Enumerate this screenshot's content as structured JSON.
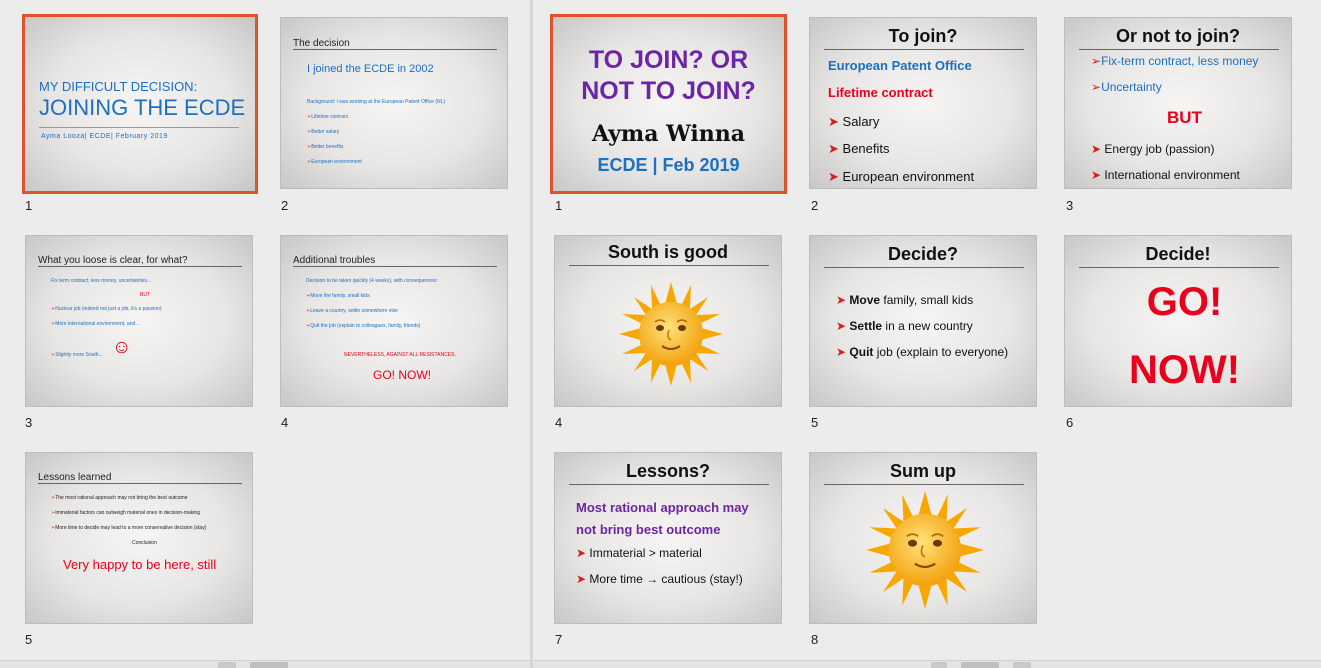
{
  "left": {
    "slides": [
      {
        "num": "1",
        "title_small": "MY DIFFICULT DECISION:",
        "title_big": "JOINING THE ECDE",
        "subtitle": "Ayma Looza| ECDE| February 2019"
      },
      {
        "num": "2",
        "heading": "The decision",
        "headline": "I joined the ECDE in 2002",
        "background": "Background: I was working at the European Patent Office (NL)",
        "bullets": [
          "Lifetime contract",
          "Better salary",
          "Better benefits",
          "European environment"
        ]
      },
      {
        "num": "3",
        "heading": "What you loose is clear, for what?",
        "line1": "Fix term contract, less money, uncertainties...",
        "but": "BUT",
        "bullets": [
          "Nuclear job (indeed not just a job, it's a passion)",
          "More international environment, and..."
        ],
        "last": "Slightly more South...",
        "smiley": "☺"
      },
      {
        "num": "4",
        "heading": "Additional troubles",
        "intro": "Decision to be taken quickly (4 weeks), with consequences:",
        "bullets": [
          "Move the family, small kids",
          "Leave a country, settle somewhere else",
          "Quit the job (explain to colleagues, family, friends)"
        ],
        "nevertheless": "NEVERTHELESS, AGAINST ALL RESISTANCES,",
        "go": "GO! NOW!"
      },
      {
        "num": "5",
        "heading": "Lessons learned",
        "bullets": [
          "The most rational approach may not bring the best outcome",
          "Immaterial factors can outweigh material ones in decision-making",
          "More time to decide may lead to a more conservative decision (stay)"
        ],
        "conclusion": "Conclusion",
        "happy": "Very happy to be here, still"
      }
    ]
  },
  "right": {
    "slides": [
      {
        "num": "1",
        "title1": "TO JOIN? OR",
        "title2": "NOT TO JOIN?",
        "author": "Ayma Winna",
        "org": "ECDE | Feb 2019"
      },
      {
        "num": "2",
        "heading": "To join?",
        "line1": "European Patent Office",
        "line2": "Lifetime contract",
        "bullets": [
          "Salary",
          "Benefits",
          "European environment"
        ]
      },
      {
        "num": "3",
        "heading": "Or not to join?",
        "b1": "Fix-term contract, less money",
        "b2": "Uncertainty",
        "but": "BUT",
        "bullets": [
          "Energy job (passion)",
          "International environment"
        ]
      },
      {
        "num": "4",
        "heading": "South is good"
      },
      {
        "num": "5",
        "heading": "Decide?",
        "bullets": [
          {
            "bold": "Move",
            "rest": " family, small kids"
          },
          {
            "bold": "Settle",
            "rest": " in a new country"
          },
          {
            "bold": "Quit",
            "rest": " job (explain to everyone)"
          }
        ]
      },
      {
        "num": "6",
        "heading": "Decide!",
        "go": "GO!",
        "now": "NOW!"
      },
      {
        "num": "7",
        "heading": "Lessons?",
        "l1": "Most rational approach may",
        "l2": "not bring best outcome",
        "bullets": [
          "Immaterial > material",
          "More time → cautious (stay!)"
        ]
      },
      {
        "num": "8",
        "heading": "Sum up"
      }
    ]
  },
  "glyphs": {
    "arrow": "➤",
    "small_arrow": "➢"
  },
  "colors": {
    "selected_border": "#e0522b",
    "blue": "#1c6fc2",
    "red": "#e8001c",
    "purple": "#6b25a6"
  }
}
